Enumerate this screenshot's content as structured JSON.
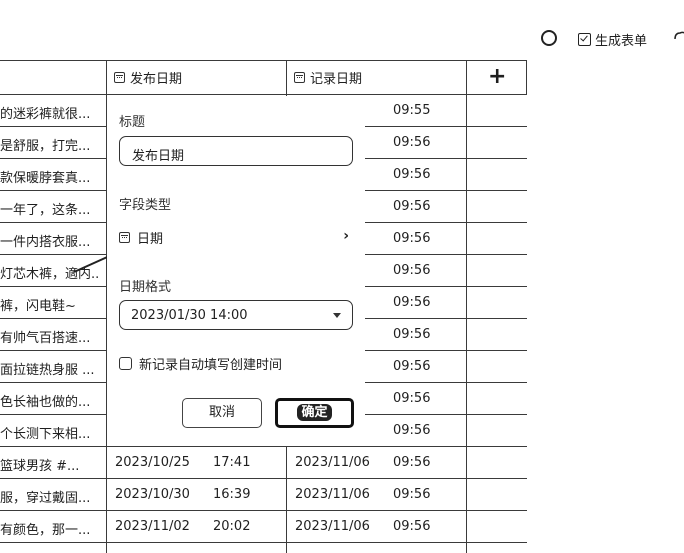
{
  "toolbar": {
    "generate_form_label": "生成表单"
  },
  "columns": {
    "publish_date": "发布日期",
    "record_date": "记录日期",
    "add": "+"
  },
  "rows_top": [
    {
      "title": "的迷彩裤就很...",
      "record_time": "09:55"
    },
    {
      "title": "是舒服，打完...",
      "record_time": "09:56"
    },
    {
      "title": "款保暖脖套真...",
      "record_time": "09:56"
    },
    {
      "title": "一年了，这条...",
      "record_time": "09:56"
    },
    {
      "title": "一件内搭衣服...",
      "record_time": "09:56"
    },
    {
      "title": "灯芯木裤，適内...",
      "record_time": "09:56"
    },
    {
      "title": "裤，闪电鞋~",
      "record_time": "09:56"
    },
    {
      "title": "有帅气百搭速...",
      "record_time": "09:56"
    },
    {
      "title": "面拉链热身服 ...",
      "record_time": "09:56"
    },
    {
      "title": "色长袖也做的...",
      "record_time": "09:56"
    },
    {
      "title": "个长测下来相...",
      "record_time": "09:56"
    }
  ],
  "rows_bottom": [
    {
      "title": "篮球男孩 #...",
      "pub_date": "2023/10/25",
      "pub_time": "17:41",
      "rec_date": "2023/11/06",
      "rec_time": "09:56"
    },
    {
      "title": "服，穿过戴固...",
      "pub_date": "2023/10/30",
      "pub_time": "16:39",
      "rec_date": "2023/11/06",
      "rec_time": "09:56"
    },
    {
      "title": "有颜色，那一...",
      "pub_date": "2023/11/02",
      "pub_time": "20:02",
      "rec_date": "2023/11/06",
      "rec_time": "09:56"
    }
  ],
  "popup": {
    "title_label": "标题",
    "title_value": "发布日期",
    "field_type_label": "字段类型",
    "field_type_value": "日期",
    "date_format_label": "日期格式",
    "date_format_value": "2023/01/30 14:00",
    "auto_fill_label": "新记录自动填写创建时间",
    "cancel_label": "取消",
    "confirm_label": "确定"
  }
}
